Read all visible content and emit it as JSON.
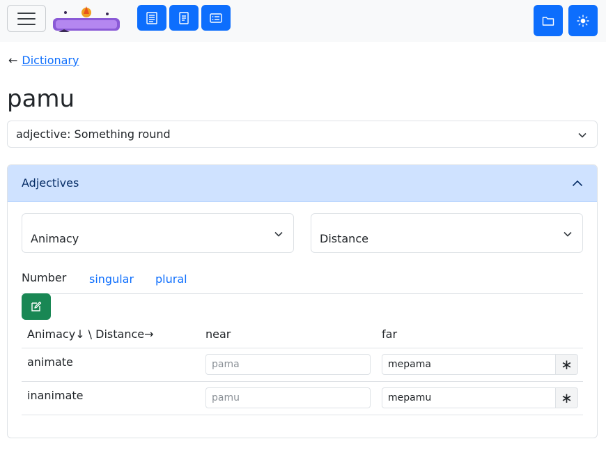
{
  "navbar": {
    "icons": [
      "menu-icon",
      "list-icon",
      "journal-icon",
      "card-list-icon",
      "folder-icon",
      "sun-icon"
    ],
    "logo_alt": "logo"
  },
  "back": {
    "arrow": "←",
    "label": "Dictionary"
  },
  "word": "pamu",
  "definition": {
    "selected": "adjective: Something round"
  },
  "accordion": {
    "title": "Adjectives",
    "animacy_label": "Animacy",
    "distance_label": "Distance",
    "number_label": "Number",
    "tabs": [
      "singular",
      "plural"
    ],
    "table": {
      "corner": "Animacy↓ \\ Distance→",
      "columns": [
        "near",
        "far"
      ],
      "rows": [
        {
          "label": "animate",
          "near": "pama",
          "far": "mepama"
        },
        {
          "label": "inanimate",
          "near": "pamu",
          "far": "mepamu"
        }
      ],
      "addon": "∗"
    }
  },
  "colors": {
    "primary": "#0d6efd",
    "success": "#198754",
    "accordion_bg": "#cfe2ff"
  }
}
